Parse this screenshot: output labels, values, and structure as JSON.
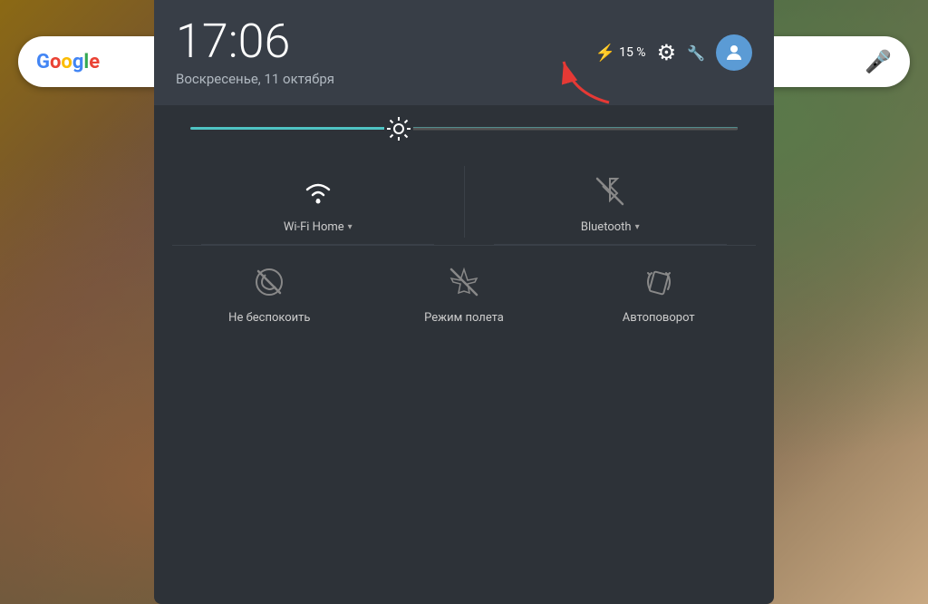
{
  "wallpaper": {
    "description": "aerial map satellite view"
  },
  "search_bar": {
    "logo": "Google",
    "mic_label": "voice search"
  },
  "panel": {
    "header": {
      "time": "17:06",
      "date": "Воскресенье, 11 октября",
      "battery_icon": "⚡",
      "battery_percent": "15 %",
      "settings_label": "settings",
      "wrench_label": "customize",
      "user_label": "user account"
    },
    "brightness": {
      "label": "brightness slider",
      "value": 38
    },
    "quick_toggles": {
      "row1": [
        {
          "id": "wifi",
          "label": "Wi-Fi Home",
          "active": true,
          "has_chevron": true
        },
        {
          "id": "bluetooth",
          "label": "Bluetooth",
          "active": false,
          "has_chevron": true
        }
      ],
      "row2": [
        {
          "id": "dnd",
          "label": "Не беспокоить",
          "active": false,
          "has_chevron": false
        },
        {
          "id": "airplane",
          "label": "Режим полета",
          "active": false,
          "has_chevron": false
        },
        {
          "id": "autorotate",
          "label": "Автоповорот",
          "active": false,
          "has_chevron": false
        }
      ]
    }
  }
}
